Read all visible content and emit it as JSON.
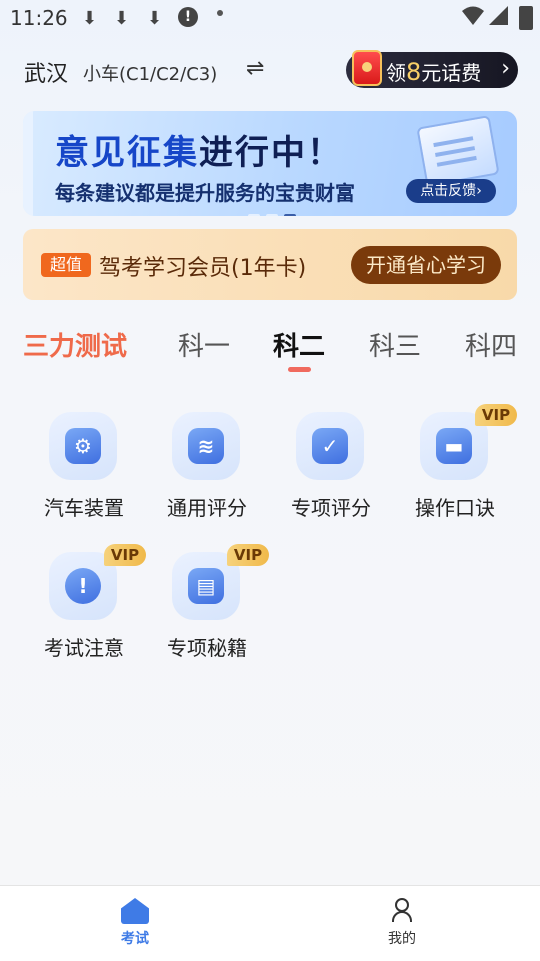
{
  "status_bar": {
    "time": "11:26",
    "icons": [
      "download-icon",
      "download-icon",
      "download-icon",
      "alert-icon",
      "dot-icon",
      "wifi-icon",
      "signal-icon",
      "battery-icon"
    ]
  },
  "header": {
    "city": "武汉",
    "car_type": "小车(C1/C2/C3)",
    "swap_symbol": "⇌",
    "promo": {
      "prefix": "领",
      "amount": "8",
      "suffix": "元话费",
      "arrow": "›"
    }
  },
  "banner": {
    "title_part1": "意见征集",
    "title_part2": "进行中！",
    "subtitle": "每条建议都是提升服务的宝贵财富",
    "button": "点击反馈",
    "button_arrow": "›",
    "page_count": 3,
    "active_page": 2
  },
  "membership": {
    "tag": "超值",
    "title": "驾考学习会员(1年卡)",
    "button": "开通省心学习"
  },
  "tabs": {
    "items": [
      "三力测试",
      "科一",
      "科二",
      "科三",
      "科四"
    ],
    "active_index": 2
  },
  "grid": {
    "items": [
      {
        "label": "汽车装置",
        "icon": "car-wrench-icon",
        "glyph": "⚙",
        "vip": ""
      },
      {
        "label": "通用评分",
        "icon": "layers-icon",
        "glyph": "≋",
        "vip": ""
      },
      {
        "label": "专项评分",
        "icon": "clipboard-check-icon",
        "glyph": "✓",
        "vip": ""
      },
      {
        "label": "操作口诀",
        "icon": "graduation-cap-icon",
        "glyph": "▬",
        "vip": "VIP"
      },
      {
        "label": "考试注意",
        "icon": "exclamation-icon",
        "glyph": "!",
        "vip": "VIP"
      },
      {
        "label": "专项秘籍",
        "icon": "book-icon",
        "glyph": "▤",
        "vip": "VIP"
      }
    ]
  },
  "bottom_nav": {
    "items": [
      {
        "label": "考试",
        "icon": "home-icon",
        "active": true
      },
      {
        "label": "我的",
        "icon": "user-icon",
        "active": false
      }
    ]
  },
  "colors": {
    "accent_blue": "#3f7be6",
    "tab_red": "#ef6a4a",
    "vip_gold": "#f0b94a",
    "member_brown": "#7a3a0b"
  }
}
